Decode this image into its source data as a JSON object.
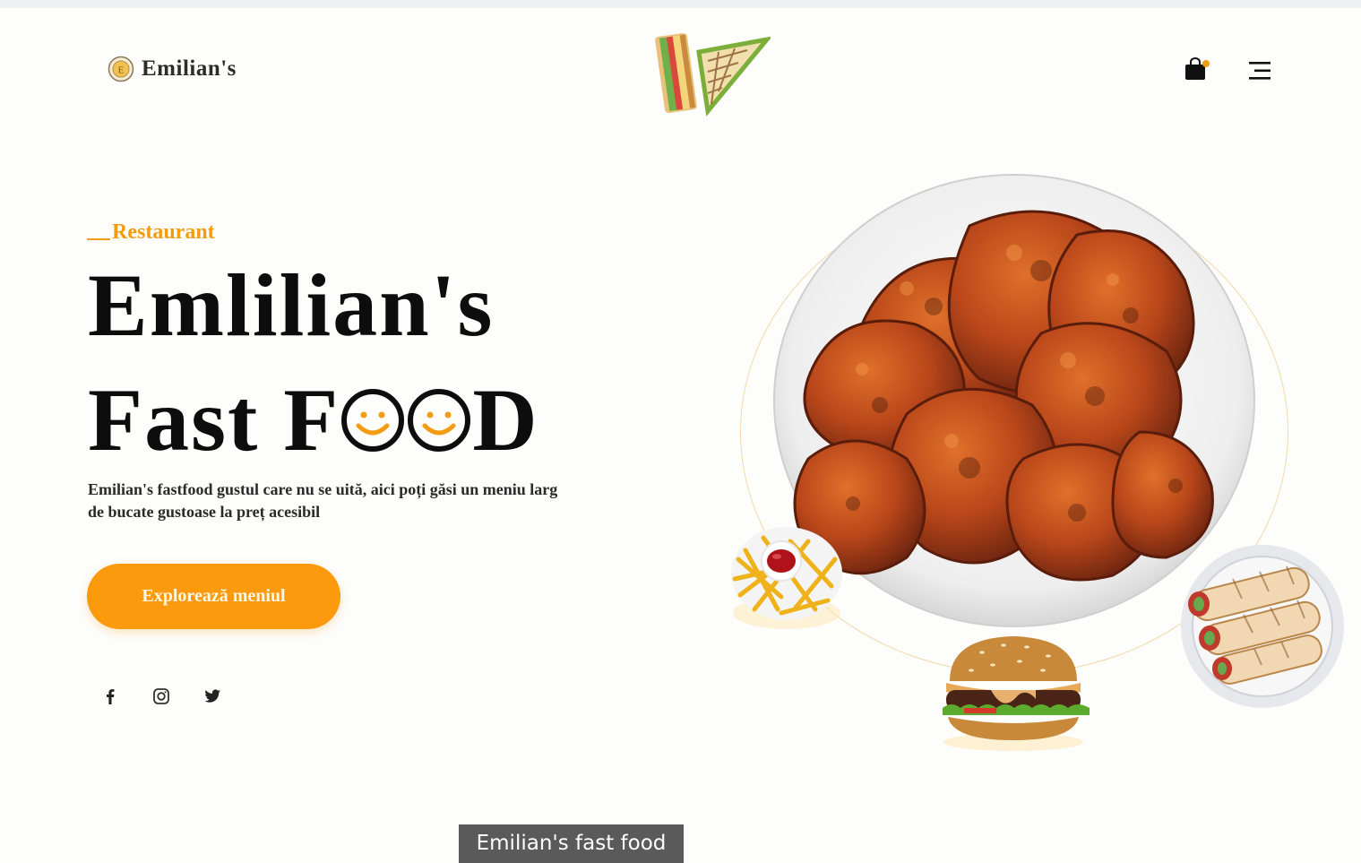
{
  "header": {
    "brand": "Emilian's",
    "icons": {
      "logo": "coin-logo-icon",
      "cart": "shopping-bag-icon",
      "menu": "hamburger-menu-icon"
    }
  },
  "hero": {
    "eyebrow": "Restaurant",
    "title_line1": "Emlilian's",
    "title_line2_prefix": "Fast F",
    "title_line2_suffix": "D",
    "description": "Emilian's fastfood gustul care nu se uită, aici poți găsi un meniu larg de bucate gustoase la preț acesibil",
    "cta_label": "Explorează meniul"
  },
  "social": [
    "facebook-icon",
    "instagram-icon",
    "twitter-icon"
  ],
  "images": [
    "sandwich-image",
    "fried-chicken-plate-image",
    "fries-image",
    "burger-image",
    "wraps-image"
  ],
  "caption": "Emilian's fast food",
  "colors": {
    "accent": "#fb9a0c",
    "eyebrow": "#f39c12",
    "text": "#0d0d0d",
    "caption_bg": "#5a5a5a"
  }
}
